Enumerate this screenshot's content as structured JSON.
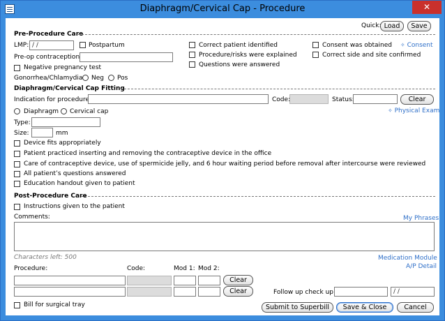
{
  "window": {
    "title": "Diaphragm/Cervical Cap - Procedure",
    "close_glyph": "✕"
  },
  "quick": {
    "label": "Quick:",
    "load": "Load",
    "save": "Save"
  },
  "pre": {
    "header": "Pre-Procedure Care",
    "lmp_label": "LMP:",
    "lmp_value": " / /",
    "postpartum": "Postpartum",
    "preop_label": "Pre-op contraception:",
    "preop_value": "",
    "negative_preg": "Negative pregnancy test",
    "gc_label": "Gonorrhea/Chlamydia:",
    "neg": "Neg",
    "pos": "Pos",
    "correct_patient": "Correct patient identified",
    "procedure_risks": "Procedure/risks were explained",
    "questions_answered": "Questions were answered",
    "consent_obtained": "Consent was obtained",
    "correct_side": "Correct side and site confirmed",
    "consent_link": "Consent"
  },
  "fitting": {
    "header": "Diaphragm/Cervical Cap Fitting",
    "indication_label": "Indication for procedure:",
    "indication_value": "",
    "code_label": "Code:",
    "status_label": "Status:",
    "clear": "Clear",
    "physical_exam": "Physical Exam",
    "diaphragm": "Diaphragm",
    "cervical_cap": "Cervical cap",
    "type_label": "Type:",
    "size_label": "Size:",
    "mm": "mm",
    "items": [
      "Device fits appropriately",
      "Patient practiced inserting and removing the contraceptive device in the office",
      "Care of contraceptive device, use of spermicide jelly, and 6 hour waiting period before removal after intercourse were reviewed",
      "All patient’s questions answered",
      "Education handout given to patient"
    ]
  },
  "post": {
    "header": "Post-Procedure Care",
    "instructions": "Instructions given to the patient",
    "comments_label": "Comments:",
    "my_phrases": "My Phrases",
    "chars_left": "Characters left: 500",
    "medication_module": "Medication Module",
    "ap_detail": "A/P Detail"
  },
  "billing": {
    "procedure_label": "Procedure:",
    "code_label": "Code:",
    "mod1_label": "Mod 1:",
    "mod2_label": "Mod 2:",
    "clear": "Clear",
    "followup_label": "Follow up check up:",
    "followup_date": " / /",
    "bill_tray": "Bill for surgical tray",
    "submit": "Submit to Superbill",
    "save_close": "Save & Close",
    "cancel": "Cancel"
  }
}
